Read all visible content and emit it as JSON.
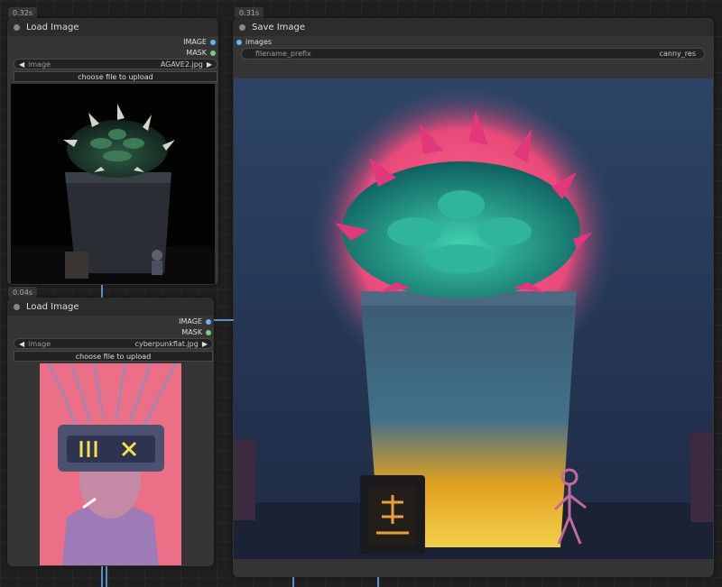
{
  "nodes": {
    "load1": {
      "time": "0.32s",
      "title": "Load Image",
      "outputs": [
        "IMAGE",
        "MASK"
      ],
      "image_widget": {
        "label": "image",
        "value": "AGAVE2.jpg"
      },
      "upload_label": "choose file to upload"
    },
    "load2": {
      "time": "0.04s",
      "title": "Load Image",
      "outputs": [
        "IMAGE",
        "MASK"
      ],
      "image_widget": {
        "label": "image",
        "value": "cyberpunkflat.jpg"
      },
      "upload_label": "choose file to upload"
    },
    "save": {
      "time": "0.31s",
      "title": "Save Image",
      "input": "images",
      "prefix_widget": {
        "label": "filename_prefix",
        "value": "canny_res"
      }
    }
  },
  "colors": {
    "image_socket": "#64b5f6",
    "mask_socket": "#81c784",
    "wire": "#5b8fc4"
  },
  "icons": {
    "left_arrow": "◀",
    "right_arrow": "▶"
  }
}
